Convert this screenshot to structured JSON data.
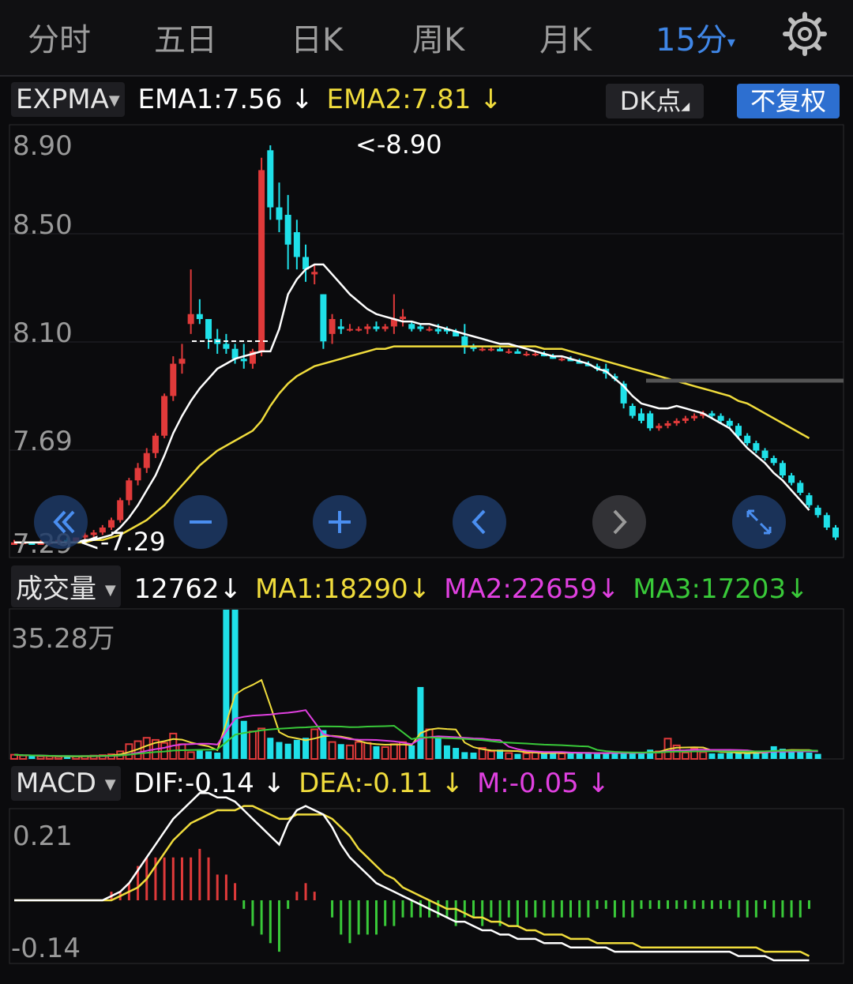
{
  "tabs": [
    "分时",
    "五日",
    "日K",
    "周K",
    "月K",
    "15分"
  ],
  "active_tab": "15分",
  "active_tab_caret": "▾",
  "icons": {
    "settings": "gear-icon",
    "fast_back": "double-chevron-left-icon",
    "zoom_out": "minus-icon",
    "zoom_in": "plus-icon",
    "prev": "chevron-left-icon",
    "next": "chevron-right-icon",
    "fullscreen": "expand-icon"
  },
  "colors": {
    "up": "#e03a3a",
    "down": "#1fe0e8",
    "ema1": "#ffffff",
    "ema2": "#f0dc3c",
    "ma2": "#e040e0",
    "ma3": "#39c939",
    "accent": "#3f86e6"
  },
  "expma": {
    "selector": "EXPMA",
    "ema1": "EMA1:7.56",
    "ema2": "EMA2:7.81",
    "arrow": "↓",
    "dk_label": "DK点",
    "adjust_label": "不复权",
    "y_labels": [
      "8.90",
      "8.50",
      "8.10",
      "7.69",
      "7.29"
    ],
    "max_marker": "<-8.90",
    "min_marker": "<-7.29"
  },
  "volume": {
    "selector": "成交量",
    "value": "12762",
    "ma1": "MA1:18290",
    "ma2": "MA2:22659",
    "ma3": "MA3:17203",
    "arrow": "↓",
    "y_label": "35.28万"
  },
  "macd": {
    "selector": "MACD",
    "dif": "DIF:-0.14",
    "dea": "DEA:-0.11",
    "m": "M:-0.05",
    "arrow": "↓",
    "y_labels": [
      "0.21",
      "-0.14"
    ]
  },
  "chart_data": {
    "type": "candlestick",
    "ylim": [
      7.29,
      8.9
    ],
    "candles": [
      {
        "o": 7.29,
        "h": 7.31,
        "l": 7.29,
        "c": 7.3
      },
      {
        "o": 7.3,
        "h": 7.31,
        "l": 7.29,
        "c": 7.3
      },
      {
        "o": 7.3,
        "h": 7.3,
        "l": 7.29,
        "c": 7.29
      },
      {
        "o": 7.29,
        "h": 7.31,
        "l": 7.29,
        "c": 7.3
      },
      {
        "o": 7.3,
        "h": 7.31,
        "l": 7.29,
        "c": 7.3
      },
      {
        "o": 7.3,
        "h": 7.31,
        "l": 7.29,
        "c": 7.31
      },
      {
        "o": 7.31,
        "h": 7.32,
        "l": 7.3,
        "c": 7.3
      },
      {
        "o": 7.3,
        "h": 7.32,
        "l": 7.3,
        "c": 7.32
      },
      {
        "o": 7.32,
        "h": 7.34,
        "l": 7.31,
        "c": 7.33
      },
      {
        "o": 7.33,
        "h": 7.35,
        "l": 7.32,
        "c": 7.34
      },
      {
        "o": 7.34,
        "h": 7.37,
        "l": 7.33,
        "c": 7.36
      },
      {
        "o": 7.36,
        "h": 7.4,
        "l": 7.35,
        "c": 7.39
      },
      {
        "o": 7.39,
        "h": 7.48,
        "l": 7.38,
        "c": 7.47
      },
      {
        "o": 7.47,
        "h": 7.56,
        "l": 7.45,
        "c": 7.55
      },
      {
        "o": 7.55,
        "h": 7.62,
        "l": 7.53,
        "c": 7.6
      },
      {
        "o": 7.6,
        "h": 7.68,
        "l": 7.58,
        "c": 7.66
      },
      {
        "o": 7.66,
        "h": 7.74,
        "l": 7.64,
        "c": 7.73
      },
      {
        "o": 7.73,
        "h": 7.9,
        "l": 7.72,
        "c": 7.89
      },
      {
        "o": 7.89,
        "h": 8.05,
        "l": 7.87,
        "c": 8.02
      },
      {
        "o": 8.02,
        "h": 8.1,
        "l": 7.98,
        "c": 8.04
      },
      {
        "o": 8.18,
        "h": 8.4,
        "l": 8.14,
        "c": 8.22
      },
      {
        "o": 8.22,
        "h": 8.28,
        "l": 8.18,
        "c": 8.2
      },
      {
        "o": 8.2,
        "h": 8.2,
        "l": 8.08,
        "c": 8.12
      },
      {
        "o": 8.12,
        "h": 8.16,
        "l": 8.06,
        "c": 8.1
      },
      {
        "o": 8.1,
        "h": 8.14,
        "l": 8.06,
        "c": 8.08
      },
      {
        "o": 8.08,
        "h": 8.1,
        "l": 8.02,
        "c": 8.04
      },
      {
        "o": 8.04,
        "h": 8.1,
        "l": 8.0,
        "c": 8.03
      },
      {
        "o": 8.02,
        "h": 8.08,
        "l": 8.0,
        "c": 8.07
      },
      {
        "o": 8.07,
        "h": 8.85,
        "l": 8.05,
        "c": 8.8
      },
      {
        "o": 8.88,
        "h": 8.9,
        "l": 8.6,
        "c": 8.65
      },
      {
        "o": 8.65,
        "h": 8.75,
        "l": 8.55,
        "c": 8.6
      },
      {
        "o": 8.62,
        "h": 8.7,
        "l": 8.4,
        "c": 8.5
      },
      {
        "o": 8.55,
        "h": 8.6,
        "l": 8.4,
        "c": 8.45
      },
      {
        "o": 8.45,
        "h": 8.5,
        "l": 8.35,
        "c": 8.4
      },
      {
        "o": 8.38,
        "h": 8.42,
        "l": 8.34,
        "c": 8.39
      },
      {
        "o": 8.3,
        "h": 8.3,
        "l": 8.08,
        "c": 8.11
      },
      {
        "o": 8.14,
        "h": 8.22,
        "l": 8.1,
        "c": 8.2
      },
      {
        "o": 8.17,
        "h": 8.2,
        "l": 8.14,
        "c": 8.16
      },
      {
        "o": 8.16,
        "h": 8.18,
        "l": 8.15,
        "c": 8.16
      },
      {
        "o": 8.16,
        "h": 8.17,
        "l": 8.15,
        "c": 8.16
      },
      {
        "o": 8.16,
        "h": 8.18,
        "l": 8.14,
        "c": 8.17
      },
      {
        "o": 8.17,
        "h": 8.19,
        "l": 8.15,
        "c": 8.16
      },
      {
        "o": 8.16,
        "h": 8.18,
        "l": 8.15,
        "c": 8.17
      },
      {
        "o": 8.17,
        "h": 8.3,
        "l": 8.14,
        "c": 8.2
      },
      {
        "o": 8.2,
        "h": 8.24,
        "l": 8.17,
        "c": 8.21
      },
      {
        "o": 8.18,
        "h": 8.19,
        "l": 8.15,
        "c": 8.16
      },
      {
        "o": 8.17,
        "h": 8.18,
        "l": 8.15,
        "c": 8.16
      },
      {
        "o": 8.16,
        "h": 8.17,
        "l": 8.15,
        "c": 8.16
      },
      {
        "o": 8.16,
        "h": 8.18,
        "l": 8.14,
        "c": 8.15
      },
      {
        "o": 8.16,
        "h": 8.17,
        "l": 8.14,
        "c": 8.15
      },
      {
        "o": 8.15,
        "h": 8.16,
        "l": 8.13,
        "c": 8.13
      },
      {
        "o": 8.13,
        "h": 8.18,
        "l": 8.06,
        "c": 8.09
      },
      {
        "o": 8.09,
        "h": 8.1,
        "l": 8.07,
        "c": 8.08
      },
      {
        "o": 8.08,
        "h": 8.09,
        "l": 8.07,
        "c": 8.08
      },
      {
        "o": 8.08,
        "h": 8.09,
        "l": 8.07,
        "c": 8.08
      },
      {
        "o": 8.08,
        "h": 8.09,
        "l": 8.07,
        "c": 8.07
      },
      {
        "o": 8.07,
        "h": 8.08,
        "l": 8.06,
        "c": 8.07
      },
      {
        "o": 8.07,
        "h": 8.08,
        "l": 8.06,
        "c": 8.06
      },
      {
        "o": 8.06,
        "h": 8.07,
        "l": 8.05,
        "c": 8.06
      },
      {
        "o": 8.06,
        "h": 8.07,
        "l": 8.05,
        "c": 8.06
      },
      {
        "o": 8.06,
        "h": 8.07,
        "l": 8.05,
        "c": 8.05
      },
      {
        "o": 8.05,
        "h": 8.06,
        "l": 8.04,
        "c": 8.04
      },
      {
        "o": 8.04,
        "h": 8.05,
        "l": 8.03,
        "c": 8.04
      },
      {
        "o": 8.04,
        "h": 8.05,
        "l": 8.03,
        "c": 8.03
      },
      {
        "o": 8.03,
        "h": 8.04,
        "l": 8.02,
        "c": 8.02
      },
      {
        "o": 8.02,
        "h": 8.03,
        "l": 8.01,
        "c": 8.01
      },
      {
        "o": 8.01,
        "h": 8.02,
        "l": 7.99,
        "c": 8.0
      },
      {
        "o": 8.0,
        "h": 8.02,
        "l": 7.96,
        "c": 7.98
      },
      {
        "o": 7.97,
        "h": 7.98,
        "l": 7.95,
        "c": 7.96
      },
      {
        "o": 7.94,
        "h": 7.95,
        "l": 7.84,
        "c": 7.86
      },
      {
        "o": 7.85,
        "h": 7.86,
        "l": 7.8,
        "c": 7.81
      },
      {
        "o": 7.82,
        "h": 7.84,
        "l": 7.78,
        "c": 7.79
      },
      {
        "o": 7.82,
        "h": 7.83,
        "l": 7.75,
        "c": 7.76
      },
      {
        "o": 7.76,
        "h": 7.78,
        "l": 7.75,
        "c": 7.77
      },
      {
        "o": 7.77,
        "h": 7.79,
        "l": 7.76,
        "c": 7.78
      },
      {
        "o": 7.78,
        "h": 7.8,
        "l": 7.77,
        "c": 7.79
      },
      {
        "o": 7.79,
        "h": 7.81,
        "l": 7.78,
        "c": 7.8
      },
      {
        "o": 7.8,
        "h": 7.82,
        "l": 7.79,
        "c": 7.81
      },
      {
        "o": 7.81,
        "h": 7.83,
        "l": 7.8,
        "c": 7.82
      },
      {
        "o": 7.82,
        "h": 7.83,
        "l": 7.8,
        "c": 7.81
      },
      {
        "o": 7.81,
        "h": 7.82,
        "l": 7.78,
        "c": 7.79
      },
      {
        "o": 7.79,
        "h": 7.8,
        "l": 7.76,
        "c": 7.77
      },
      {
        "o": 7.77,
        "h": 7.78,
        "l": 7.72,
        "c": 7.73
      },
      {
        "o": 7.73,
        "h": 7.74,
        "l": 7.69,
        "c": 7.7
      },
      {
        "o": 7.7,
        "h": 7.71,
        "l": 7.66,
        "c": 7.67
      },
      {
        "o": 7.67,
        "h": 7.68,
        "l": 7.63,
        "c": 7.64
      },
      {
        "o": 7.64,
        "h": 7.65,
        "l": 7.61,
        "c": 7.62
      },
      {
        "o": 7.62,
        "h": 7.63,
        "l": 7.56,
        "c": 7.57
      },
      {
        "o": 7.57,
        "h": 7.58,
        "l": 7.53,
        "c": 7.54
      },
      {
        "o": 7.54,
        "h": 7.55,
        "l": 7.49,
        "c": 7.5
      },
      {
        "o": 7.49,
        "h": 7.5,
        "l": 7.44,
        "c": 7.45
      },
      {
        "o": 7.44,
        "h": 7.45,
        "l": 7.4,
        "c": 7.41
      },
      {
        "o": 7.41,
        "h": 7.42,
        "l": 7.35,
        "c": 7.36
      },
      {
        "o": 7.36,
        "h": 7.37,
        "l": 7.31,
        "c": 7.32
      }
    ],
    "ema1": [
      7.3,
      7.3,
      7.3,
      7.3,
      7.3,
      7.3,
      7.3,
      7.3,
      7.31,
      7.31,
      7.32,
      7.33,
      7.36,
      7.4,
      7.45,
      7.51,
      7.57,
      7.65,
      7.74,
      7.81,
      7.87,
      7.92,
      7.96,
      8.0,
      8.02,
      8.04,
      8.05,
      8.06,
      8.07,
      8.07,
      8.16,
      8.3,
      8.36,
      8.4,
      8.42,
      8.42,
      8.38,
      8.34,
      8.3,
      8.27,
      8.24,
      8.22,
      8.21,
      8.2,
      8.19,
      8.19,
      8.18,
      8.18,
      8.17,
      8.16,
      8.15,
      8.14,
      8.13,
      8.12,
      8.11,
      8.1,
      8.1,
      8.09,
      8.08,
      8.07,
      8.06,
      8.05,
      8.05,
      8.04,
      8.03,
      8.02,
      8.0,
      7.99,
      7.96,
      7.93,
      7.89,
      7.86,
      7.85,
      7.84,
      7.84,
      7.85,
      7.84,
      7.83,
      7.82,
      7.8,
      7.78,
      7.76,
      7.72,
      7.68,
      7.65,
      7.62,
      7.58,
      7.55,
      7.51,
      7.47,
      7.43
    ],
    "ema2": [
      7.3,
      7.3,
      7.3,
      7.3,
      7.3,
      7.3,
      7.3,
      7.3,
      7.3,
      7.31,
      7.31,
      7.32,
      7.33,
      7.35,
      7.37,
      7.39,
      7.42,
      7.45,
      7.49,
      7.53,
      7.57,
      7.61,
      7.64,
      7.67,
      7.69,
      7.71,
      7.73,
      7.75,
      7.79,
      7.85,
      7.9,
      7.94,
      7.97,
      7.99,
      8.01,
      8.02,
      8.03,
      8.04,
      8.05,
      8.06,
      8.07,
      8.08,
      8.08,
      8.09,
      8.09,
      8.09,
      8.09,
      8.09,
      8.09,
      8.09,
      8.09,
      8.09,
      8.09,
      8.09,
      8.09,
      8.09,
      8.09,
      8.09,
      8.09,
      8.09,
      8.08,
      8.08,
      8.08,
      8.07,
      8.06,
      8.05,
      8.04,
      8.03,
      8.02,
      8.01,
      8.0,
      7.99,
      7.98,
      7.97,
      7.96,
      7.95,
      7.94,
      7.93,
      7.92,
      7.91,
      7.9,
      7.89,
      7.87,
      7.86,
      7.84,
      7.82,
      7.8,
      7.78,
      7.76,
      7.74,
      7.72
    ],
    "volume": [
      1.0,
      0.8,
      0.7,
      0.6,
      0.6,
      0.5,
      0.6,
      0.6,
      0.7,
      0.8,
      0.9,
      1.1,
      1.8,
      3.5,
      4.2,
      5.0,
      4.5,
      3.8,
      6.0,
      3.5,
      1.6,
      2.0,
      1.8,
      1.5,
      35.28,
      35.28,
      9.0,
      6.5,
      7.2,
      5.0,
      4.0,
      3.6,
      4.5,
      5.0,
      7.0,
      6.8,
      4.0,
      3.5,
      3.2,
      4.0,
      3.8,
      3.0,
      2.8,
      3.5,
      4.0,
      3.2,
      17.0,
      7.0,
      5.0,
      3.2,
      2.6,
      1.6,
      1.5,
      2.6,
      1.8,
      2.2,
      1.4,
      1.2,
      1.3,
      1.5,
      1.3,
      1.7,
      1.3,
      1.4,
      1.4,
      1.5,
      1.2,
      1.3,
      1.6,
      1.5,
      1.4,
      1.3,
      2.2,
      1.8,
      4.8,
      3.2,
      1.5,
      2.4,
      1.6,
      1.3,
      1.3,
      1.4,
      1.6,
      1.3,
      1.7,
      1.5,
      3.0,
      2.4,
      2.0,
      1.6,
      1.5,
      1.2
    ],
    "macd": {
      "ylim": [
        -0.14,
        0.21
      ],
      "dif": [
        0.0,
        0.0,
        0.0,
        0.0,
        0.0,
        0.0,
        0.0,
        0.0,
        0.0,
        0.0,
        0.0,
        0.01,
        0.02,
        0.04,
        0.07,
        0.1,
        0.13,
        0.16,
        0.19,
        0.21,
        0.23,
        0.25,
        0.25,
        0.24,
        0.24,
        0.23,
        0.21,
        0.19,
        0.17,
        0.15,
        0.13,
        0.18,
        0.21,
        0.22,
        0.21,
        0.2,
        0.17,
        0.13,
        0.1,
        0.08,
        0.06,
        0.04,
        0.03,
        0.02,
        0.01,
        0.0,
        -0.01,
        -0.02,
        -0.03,
        -0.04,
        -0.05,
        -0.05,
        -0.06,
        -0.07,
        -0.07,
        -0.08,
        -0.08,
        -0.09,
        -0.09,
        -0.09,
        -0.1,
        -0.1,
        -0.1,
        -0.11,
        -0.11,
        -0.11,
        -0.11,
        -0.11,
        -0.12,
        -0.12,
        -0.12,
        -0.12,
        -0.12,
        -0.12,
        -0.12,
        -0.12,
        -0.12,
        -0.12,
        -0.12,
        -0.12,
        -0.12,
        -0.12,
        -0.13,
        -0.13,
        -0.13,
        -0.13,
        -0.14,
        -0.14,
        -0.14,
        -0.14,
        -0.14
      ],
      "dea": [
        0.0,
        0.0,
        0.0,
        0.0,
        0.0,
        0.0,
        0.0,
        0.0,
        0.0,
        0.0,
        0.0,
        0.0,
        0.01,
        0.02,
        0.03,
        0.05,
        0.08,
        0.11,
        0.14,
        0.16,
        0.18,
        0.19,
        0.2,
        0.21,
        0.21,
        0.21,
        0.22,
        0.22,
        0.21,
        0.2,
        0.19,
        0.19,
        0.2,
        0.2,
        0.2,
        0.2,
        0.19,
        0.17,
        0.15,
        0.12,
        0.1,
        0.08,
        0.06,
        0.05,
        0.03,
        0.02,
        0.01,
        0.0,
        -0.01,
        -0.02,
        -0.02,
        -0.03,
        -0.04,
        -0.04,
        -0.05,
        -0.05,
        -0.06,
        -0.06,
        -0.07,
        -0.07,
        -0.08,
        -0.08,
        -0.08,
        -0.09,
        -0.09,
        -0.09,
        -0.1,
        -0.1,
        -0.1,
        -0.1,
        -0.1,
        -0.11,
        -0.11,
        -0.11,
        -0.11,
        -0.11,
        -0.11,
        -0.11,
        -0.11,
        -0.11,
        -0.11,
        -0.11,
        -0.11,
        -0.11,
        -0.11,
        -0.12,
        -0.12,
        -0.12,
        -0.12,
        -0.12,
        -0.13
      ]
    }
  }
}
